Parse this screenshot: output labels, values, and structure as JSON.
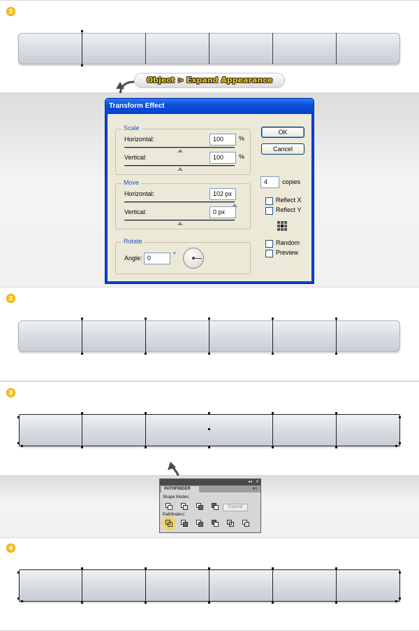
{
  "steps": {
    "s1": "1",
    "s2": "2",
    "s3": "3",
    "s4": "4"
  },
  "callout": {
    "text": "Object > Expand Appearance"
  },
  "dialog": {
    "title": "Transform Effect",
    "scale": {
      "title": "Scale",
      "h_label": "Horizontal:",
      "h_value": "100",
      "h_unit": "%",
      "v_label": "Vertical:",
      "v_value": "100",
      "v_unit": "%"
    },
    "move": {
      "title": "Move",
      "h_label": "Horizontal:",
      "h_value": "102 px",
      "v_label": "Vertical:",
      "v_value": "0 px"
    },
    "rotate": {
      "title": "Rotate",
      "angle_label": "Angle:",
      "angle_value": "0",
      "degree": "°"
    },
    "ok": "OK",
    "cancel": "Cancel",
    "copies_value": "4",
    "copies_label": "copies",
    "reflect_x": "Reflect X",
    "reflect_y": "Reflect Y",
    "random": "Random",
    "preview": "Preview"
  },
  "pathfinder": {
    "tab": "PATHFINDER",
    "shape_modes": "Shape Modes:",
    "expand": "Expand",
    "pathfinders": "Pathfinders:",
    "collapse": "◂◂",
    "close": "✕",
    "menu": "▾≡"
  },
  "colors": {
    "step_badge": "#f7c21a",
    "dialog_title": "#0b4fdc",
    "highlight": "#f5cc32"
  }
}
